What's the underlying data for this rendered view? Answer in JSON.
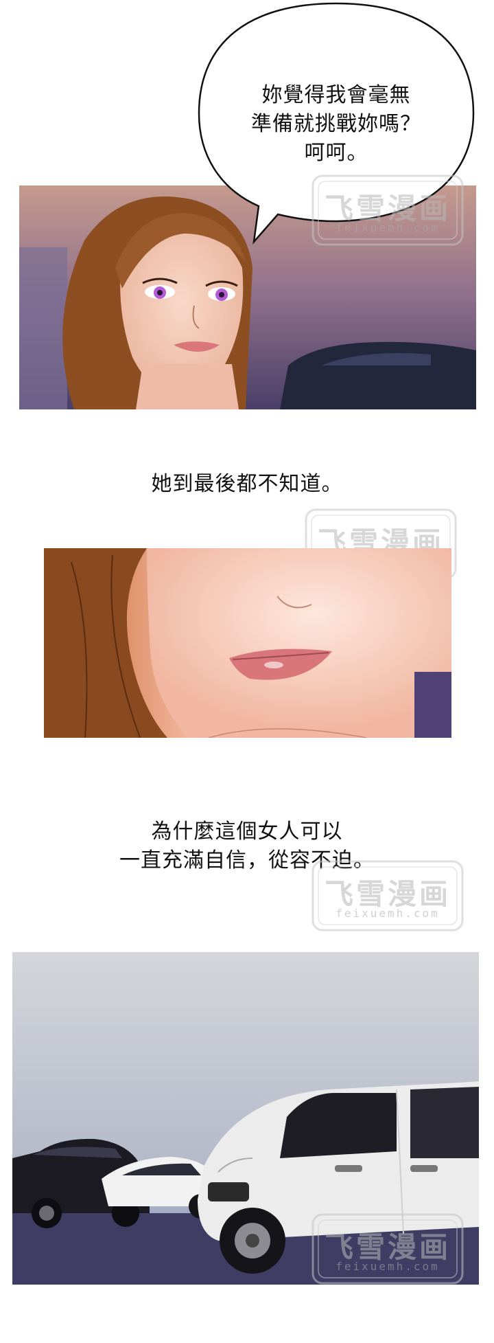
{
  "page": {
    "background": "#ffffff"
  },
  "speech_bubble": {
    "lines": [
      "妳覺得我會毫無",
      "準備就挑戰妳嗎？",
      "呵呵。"
    ]
  },
  "narration": {
    "caption_1": "她到最後都不知道。",
    "caption_2_lines": [
      "為什麼這個女人可以",
      "一直充滿自信，從容不迫。"
    ]
  },
  "watermark": {
    "title": "飞雪漫画",
    "subtitle": "feixuemh.com"
  },
  "colors": {
    "skin": "#f4c9b6",
    "hair": "#8a4c22",
    "sky_top": "#cfd3d8",
    "sky_bottom": "#9aa6bf",
    "ground": "#3f3d63",
    "van": "#ececec",
    "iris": "#b45bd6",
    "lips": "#d9767a"
  }
}
